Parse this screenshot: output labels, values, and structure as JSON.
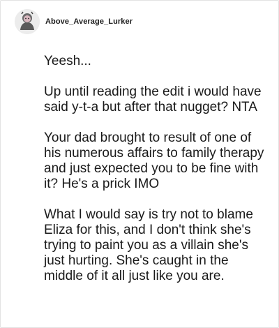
{
  "post": {
    "username": "Above_Average_Lurker",
    "avatar_icon": "avatar-icon",
    "paragraphs": [
      "Yeesh...",
      "Up until reading the edit i would have said y-t-a but after that nugget? NTA",
      "Your dad brought to result of one of his numerous affairs to family therapy and just expected you to be fine with it? He's a prick IMO",
      "What I would say is try not to blame Eliza for this, and I don't think she's trying to paint you as a villain she's just hurting. She's caught in the middle of it all just like you are."
    ]
  }
}
